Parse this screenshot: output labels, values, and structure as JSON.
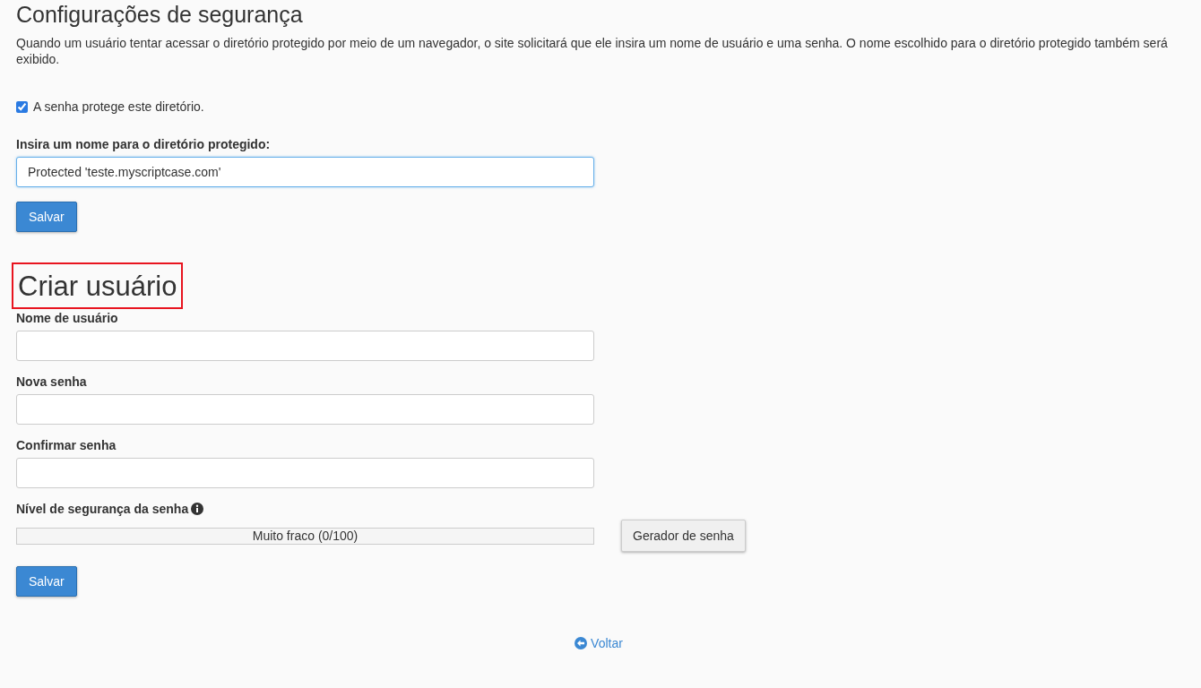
{
  "security": {
    "title": "Configurações de segurança",
    "description": "Quando um usuário tentar acessar o diretório protegido por meio de um navegador, o site solicitará que ele insira um nome de usuário e uma senha. O nome escolhido para o diretório protegido também será exibido.",
    "protect_checkbox": {
      "label": "A senha protege este diretório.",
      "checked": true
    },
    "name_field": {
      "label": "Insira um nome para o diretório protegido:",
      "value": "Protected 'teste.myscriptcase.com'"
    },
    "save_button": "Salvar"
  },
  "create_user": {
    "title": "Criar usuário",
    "highlighted": true,
    "fields": [
      {
        "label": "Nome de usuário"
      },
      {
        "label": "Nova senha"
      },
      {
        "label": "Confirmar senha"
      }
    ],
    "strength": {
      "label": "Nível de segurança da senha",
      "level": 0,
      "reading": "Muito fraco (0/100)"
    },
    "generator_button": "Gerador de senha",
    "save_button": "Salvar"
  },
  "back_link": "Voltar"
}
